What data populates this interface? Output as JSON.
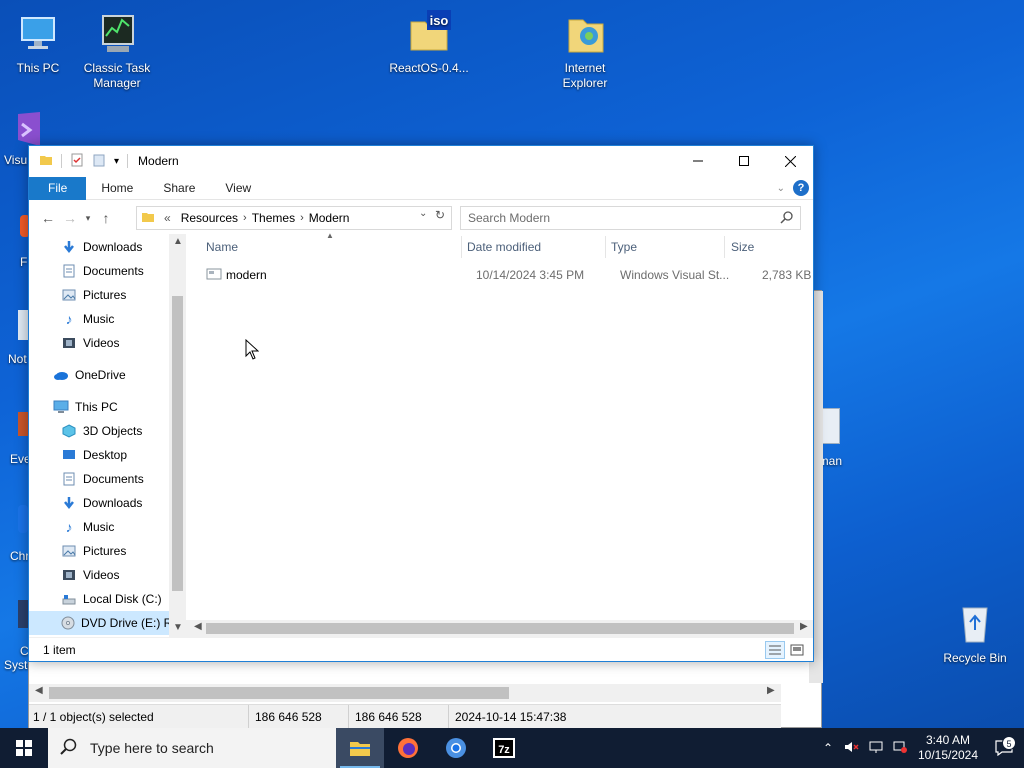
{
  "desktop": {
    "icons": [
      {
        "label": "This PC",
        "icon": "monitor-icon"
      },
      {
        "label": "Classic Task Manager",
        "icon": "task-manager-icon"
      },
      {
        "label": "ReactOS-0.4...",
        "icon": "iso-file-icon"
      },
      {
        "label": "Internet Explorer",
        "icon": "internet-explorer-icon"
      },
      {
        "label": "Recycle Bin",
        "icon": "recycle-bin-icon"
      }
    ],
    "partial_labels": [
      "Visu",
      "F",
      "Not",
      "Eve",
      "Chr",
      "C",
      "Syste",
      "gman"
    ]
  },
  "background_window": {
    "status": {
      "selected": "1 / 1 object(s) selected",
      "size1": "186 646 528",
      "size2": "186 646 528",
      "modified": "2024-10-14 15:47:38"
    }
  },
  "explorer": {
    "title": "Modern",
    "ribbon_tabs": [
      "File",
      "Home",
      "Share",
      "View"
    ],
    "breadcrumbs": [
      "Resources",
      "Themes",
      "Modern"
    ],
    "breadcrumb_overflow": "«",
    "search_placeholder": "Search Modern",
    "nav": {
      "quick_access": [
        {
          "label": "Downloads",
          "icon": "download-icon",
          "pinned": true
        },
        {
          "label": "Documents",
          "icon": "document-icon",
          "pinned": true
        },
        {
          "label": "Pictures",
          "icon": "picture-icon",
          "pinned": true
        },
        {
          "label": "Music",
          "icon": "music-icon",
          "pinned": false
        },
        {
          "label": "Videos",
          "icon": "video-icon",
          "pinned": false
        }
      ],
      "onedrive": "OneDrive",
      "this_pc": "This PC",
      "this_pc_items": [
        {
          "label": "3D Objects",
          "icon": "cube-icon"
        },
        {
          "label": "Desktop",
          "icon": "desktop-icon"
        },
        {
          "label": "Documents",
          "icon": "document-icon"
        },
        {
          "label": "Downloads",
          "icon": "download-icon"
        },
        {
          "label": "Music",
          "icon": "music-icon"
        },
        {
          "label": "Pictures",
          "icon": "picture-icon"
        },
        {
          "label": "Videos",
          "icon": "video-icon"
        },
        {
          "label": "Local Disk (C:)",
          "icon": "drive-icon"
        },
        {
          "label": "DVD Drive (E:) Re",
          "icon": "dvd-icon",
          "selected": true
        }
      ]
    },
    "columns": [
      "Name",
      "Date modified",
      "Type",
      "Size"
    ],
    "files": [
      {
        "name": "modern",
        "date": "10/14/2024 3:45 PM",
        "type": "Windows Visual St...",
        "size": "2,783 KB"
      }
    ],
    "status_count": "1 item"
  },
  "taskbar": {
    "search_placeholder": "Type here to search",
    "apps": [
      "file-explorer-icon",
      "firefox-icon",
      "chrome-icon",
      "7zip-icon"
    ],
    "time": "3:40 AM",
    "date": "10/15/2024",
    "notification_count": "5"
  }
}
